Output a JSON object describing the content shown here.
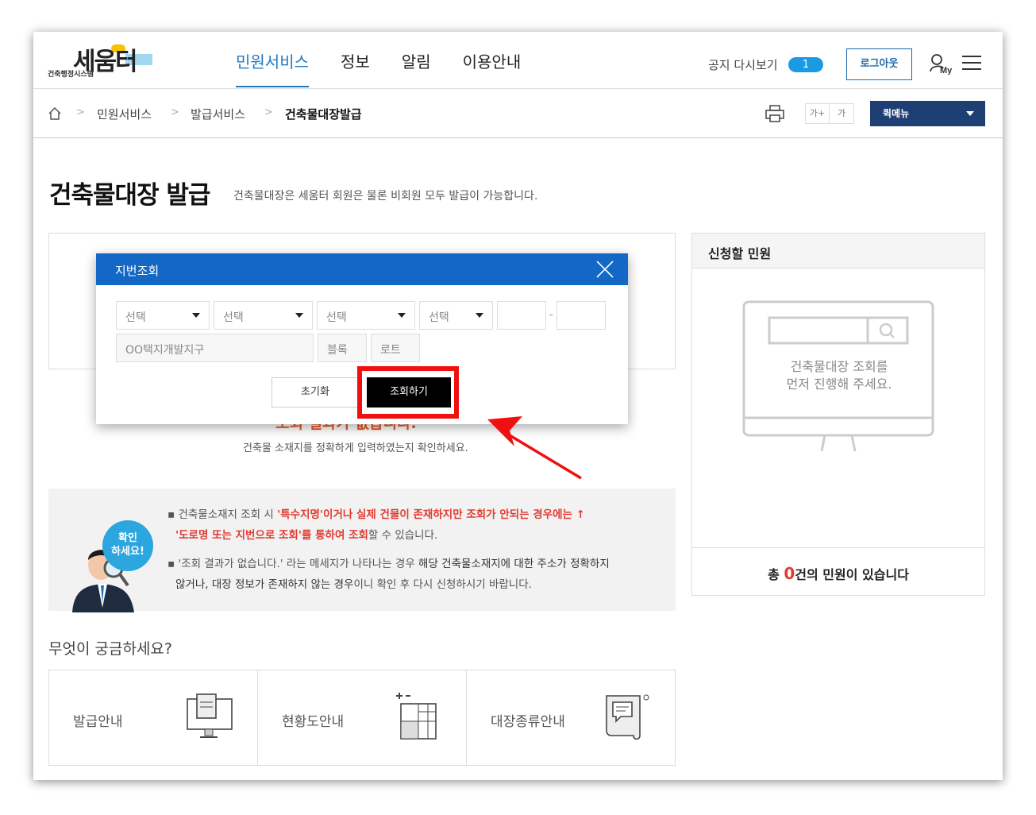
{
  "header": {
    "logo_text": "세움터",
    "logo_sub": "건축행정시스템",
    "nav": [
      "민원서비스",
      "정보",
      "알림",
      "이용안내"
    ],
    "notice_label": "공지 다시보기",
    "notice_count": "1",
    "logout_label": "로그아웃",
    "my_label": "My"
  },
  "breadcrumb": {
    "items": [
      "민원서비스",
      "발급서비스",
      "건축물대장발급"
    ],
    "font_up": "가+",
    "font_down": "가",
    "quick_menu": "퀵메뉴"
  },
  "page": {
    "title": "건축물대장 발급",
    "description": "건축물대장은 세움터 회원은 물론 비회원 모두 발급이 가능합니다."
  },
  "modal": {
    "title": "지번조회",
    "selects": [
      "선택",
      "선택",
      "선택",
      "선택"
    ],
    "district_placeholder": "OO택지개발지구",
    "block_placeholder": "블록",
    "lot_placeholder": "로트",
    "dash": "-",
    "reset_label": "초기화",
    "search_label": "조회하기"
  },
  "result": {
    "no_result": "조회 결과가 없습니다.",
    "hint": "건축물 소재지를 정확하게 입력하였는지 확인하세요."
  },
  "info": {
    "bubble_line1": "확인",
    "bubble_line2": "하세요!",
    "l1_a": "건축물소재지 조회 시 ",
    "l1_b": "'특수지명'이거나 실제 건물이 존재하지만 조회가 안되는 경우에는 ↑",
    "l2_a": "'도로명 또는 지번으로 조회'를 통하여 조회",
    "l2_b": "할 수 있습니다.",
    "l3_a": "'조회 결과가 없습니다.' 라는 메세지가 나타나는 경우 ",
    "l3_b": "해당 건축물소재지에 대한 주소가 정확하지",
    "l4_a": "않거나, 대장 정보가 존재하지 않는 경우",
    "l4_b": "이니 확인 후 다시 신청하시기 바랍니다."
  },
  "faq": {
    "title": "무엇이 궁금하세요?",
    "items": [
      "발급안내",
      "현황도안내",
      "대장종류안내"
    ]
  },
  "side": {
    "title": "신청할 민원",
    "msg1": "건축물대장 조회를",
    "msg2": "먼저 진행해 주세요.",
    "foot_a": "총 ",
    "foot_count": "0",
    "foot_b": "건의 민원이 있습니다"
  },
  "colors": {
    "primary": "#1367c5",
    "nav_active": "#1f7ac6",
    "quick_menu": "#1e3f73",
    "alert_red": "#e03c31",
    "highlight": "#f01010"
  }
}
